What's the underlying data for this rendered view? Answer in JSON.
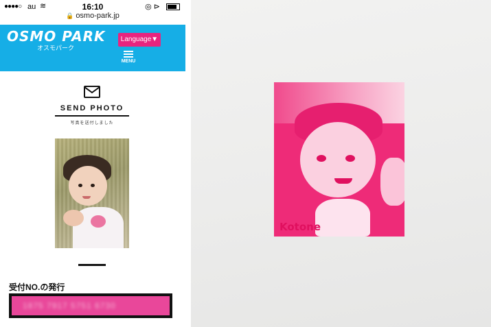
{
  "status_bar": {
    "signal": "●●●●○",
    "carrier": "au",
    "wifi_icon": "wifi-icon",
    "time": "16:10",
    "right_icons": "◎ ⊳"
  },
  "url_bar": {
    "url": "osmo-park.jp"
  },
  "header": {
    "logo": "OSMO PARK",
    "logo_sub": "オスモパーク",
    "language_button": "Language▼",
    "menu_label": "MENU",
    "bg_color": "#16aee6",
    "accent_color": "#e9247f"
  },
  "send_photo": {
    "title": "SEND PHOTO",
    "subtitle": "写真を送付しました"
  },
  "issue": {
    "label": "受付NO.の発行",
    "number": "1875 7917 5751 6730"
  },
  "print": {
    "name": "Kotone"
  }
}
